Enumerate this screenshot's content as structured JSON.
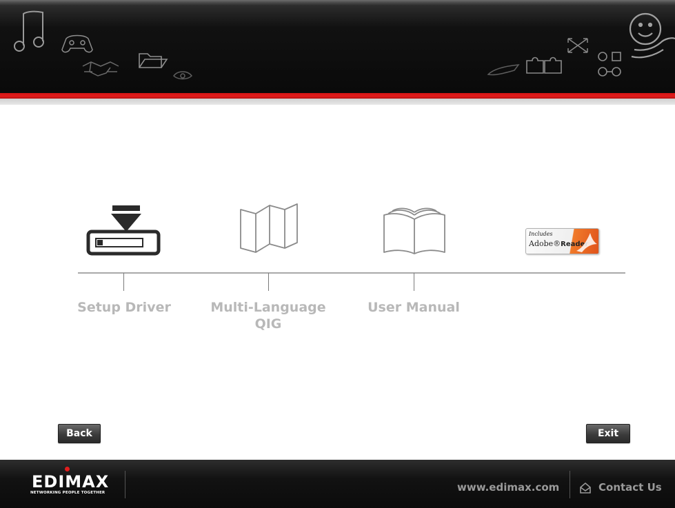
{
  "header": {
    "decor_icons": [
      "music-notes-icon",
      "gamepad-icon",
      "handshake-icon",
      "folder-icon",
      "eye-icon",
      "pen-icon",
      "puzzle-icon",
      "arrows-icon",
      "network-icon",
      "smiley-icon"
    ],
    "accent_color": "#e11d1d"
  },
  "menu": {
    "items": [
      {
        "label": "Setup Driver",
        "icon": "download-drive-icon"
      },
      {
        "label": "Multi-Language QIG",
        "icon": "folded-map-icon"
      },
      {
        "label": "User Manual",
        "icon": "open-book-icon"
      },
      {
        "label": "",
        "icon": "adobe-reader-badge"
      }
    ],
    "adobe_badge": {
      "includes": "Includes",
      "product": "Adobe",
      "product_bold": "Reader"
    }
  },
  "buttons": {
    "back": "Back",
    "exit": "Exit"
  },
  "footer": {
    "brand": "EDIMAX",
    "tagline": "NETWORKING PEOPLE TOGETHER",
    "website": "www.edimax.com",
    "contact": "Contact Us"
  }
}
